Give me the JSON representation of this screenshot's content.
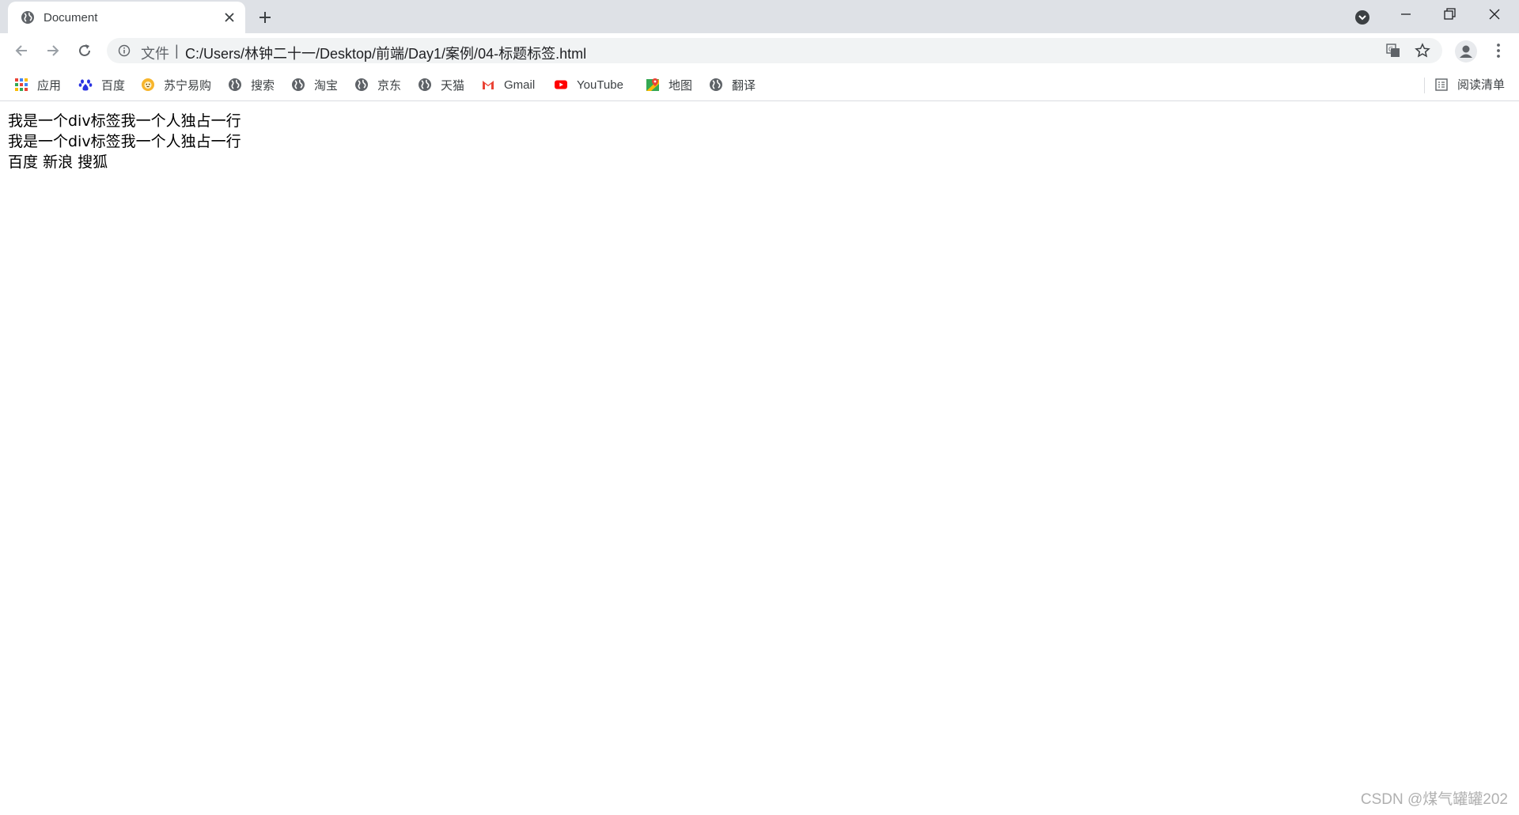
{
  "colors": {
    "tabstrip_bg": "#dee1e6",
    "omnibox_bg": "#f1f3f4",
    "text_primary": "#202124",
    "watermark": "#b0b0b0"
  },
  "tab": {
    "title": "Document",
    "favicon": "globe-icon"
  },
  "toolbar": {
    "scheme_label": "文件",
    "separator": "|",
    "url": "C:/Users/林钟二十一/Desktop/前端/Day1/案例/04-标题标签.html"
  },
  "bookmarks": [
    {
      "label": "应用",
      "icon": "apps-grid-icon"
    },
    {
      "label": "百度",
      "icon": "baidu-paw-icon"
    },
    {
      "label": "苏宁易购",
      "icon": "suning-lion-icon"
    },
    {
      "label": "搜索",
      "icon": "globe-icon"
    },
    {
      "label": "淘宝",
      "icon": "globe-icon"
    },
    {
      "label": "京东",
      "icon": "globe-icon"
    },
    {
      "label": "天猫",
      "icon": "globe-icon"
    },
    {
      "label": "Gmail",
      "icon": "gmail-icon"
    },
    {
      "label": "YouTube",
      "icon": "youtube-icon"
    },
    {
      "label": "地图",
      "icon": "maps-pin-icon"
    },
    {
      "label": "翻译",
      "icon": "globe-icon"
    }
  ],
  "reading_list": {
    "label": "阅读清单",
    "icon": "reading-list-icon"
  },
  "page": {
    "line1": "我是一个div标签我一个人独占一行",
    "line2": "我是一个div标签我一个人独占一行",
    "links": [
      "百度",
      "新浪",
      "搜狐"
    ]
  },
  "watermark": "CSDN @煤气罐罐202"
}
